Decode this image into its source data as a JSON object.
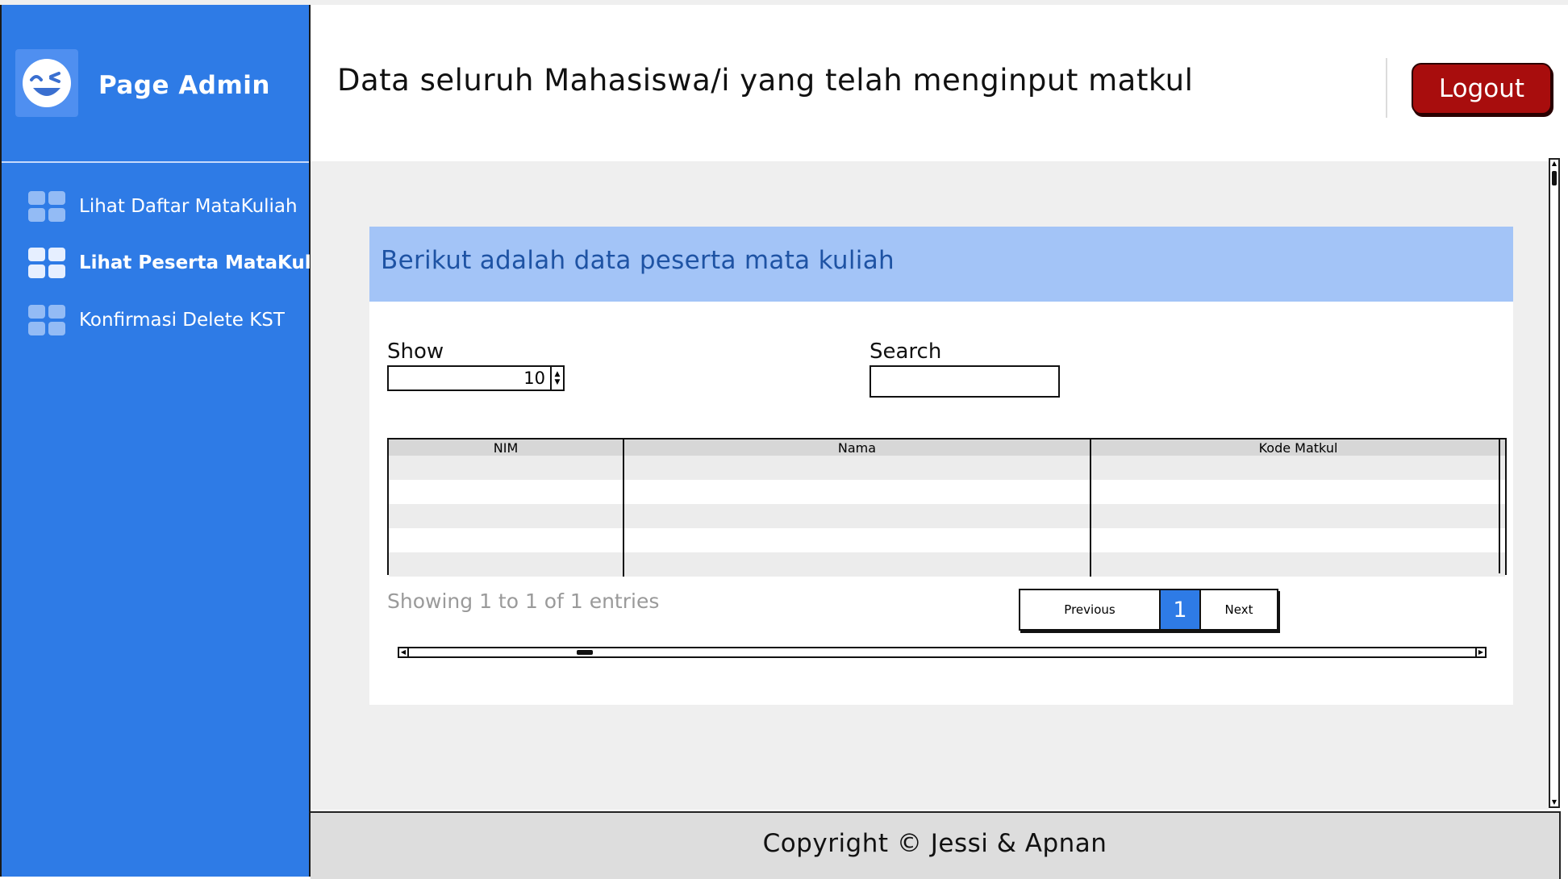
{
  "sidebar": {
    "app_title": "Page Admin",
    "logo_icon": "smiley-wink-icon",
    "items": [
      {
        "label": "Lihat Daftar MataKuliah",
        "icon": "grid-icon",
        "active": false
      },
      {
        "label": "Lihat Peserta MataKuliah",
        "icon": "grid-icon",
        "active": true
      },
      {
        "label": "Konfirmasi Delete KST",
        "icon": "grid-icon",
        "active": false
      }
    ]
  },
  "header": {
    "title": "Data seluruh Mahasiswa/i yang telah menginput matkul",
    "logout_label": "Logout"
  },
  "panel": {
    "title": "Berikut adalah data peserta mata kuliah",
    "show_label": "Show",
    "show_value": "10",
    "search_label": "Search",
    "search_value": "",
    "table": {
      "columns": [
        "NIM",
        "Nama",
        "Kode Matkul"
      ],
      "rows": []
    },
    "showing_text": "Showing 1 to 1 of 1 entries",
    "pagination": {
      "previous_label": "Previous",
      "current_page": "1",
      "next_label": "Next"
    }
  },
  "footer": {
    "copyright": "Copyright © Jessi & Apnan"
  },
  "colors": {
    "sidebar_bg": "#2e7be6",
    "panel_header_bg": "#a3c4f7",
    "panel_title": "#1e53a4",
    "logout_bg": "#a80d0d",
    "main_bg": "#efefef",
    "footer_bg": "#dddddd"
  }
}
